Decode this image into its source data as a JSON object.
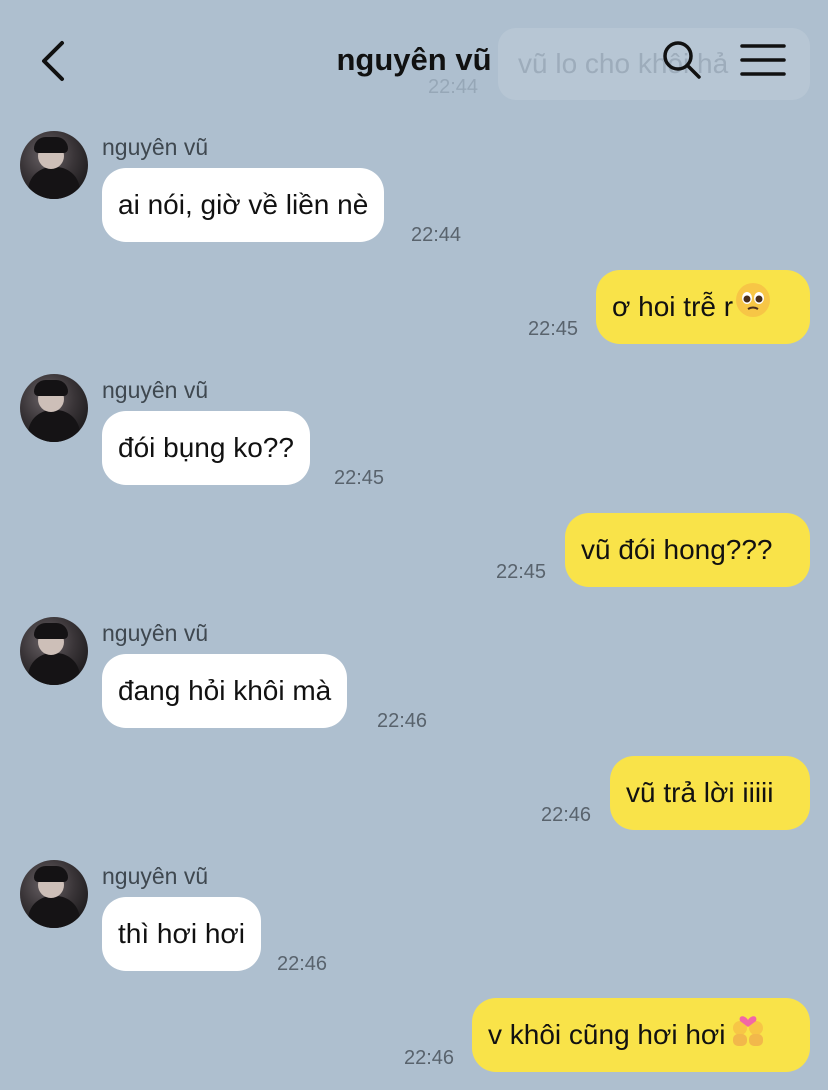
{
  "header": {
    "title": "nguyên vũ",
    "ghost_preview_text": "vũ lo cho khôi hả",
    "ghost_preview_time": "22:44"
  },
  "messages": [
    {
      "sender": "nguyên vũ",
      "text": "ai nói, giờ về liền nè",
      "time": "22:44",
      "direction": "in"
    },
    {
      "text": "ơ hoi trễ r",
      "time": "22:45",
      "direction": "out",
      "emoji": "pleading-face"
    },
    {
      "sender": "nguyên vũ",
      "text": "đói bụng ko??",
      "time": "22:45",
      "direction": "in"
    },
    {
      "text": "vũ đói hong???",
      "time": "22:45",
      "direction": "out"
    },
    {
      "sender": "nguyên vũ",
      "text": "đang hỏi khôi mà",
      "time": "22:46",
      "direction": "in"
    },
    {
      "text": "vũ trả lời iiiii",
      "time": "22:46",
      "direction": "out"
    },
    {
      "sender": "nguyên vũ",
      "text": "thì hơi hơi",
      "time": "22:46",
      "direction": "in"
    },
    {
      "text": "v khôi cũng hơi hơi",
      "time": "22:46",
      "direction": "out",
      "emoji": "couple-with-heart"
    }
  ],
  "colors": {
    "background": "#aebfcf",
    "incoming_bubble": "#ffffff",
    "outgoing_bubble": "#f9e349"
  },
  "icons": [
    "back-icon",
    "search-icon",
    "menu-icon"
  ]
}
